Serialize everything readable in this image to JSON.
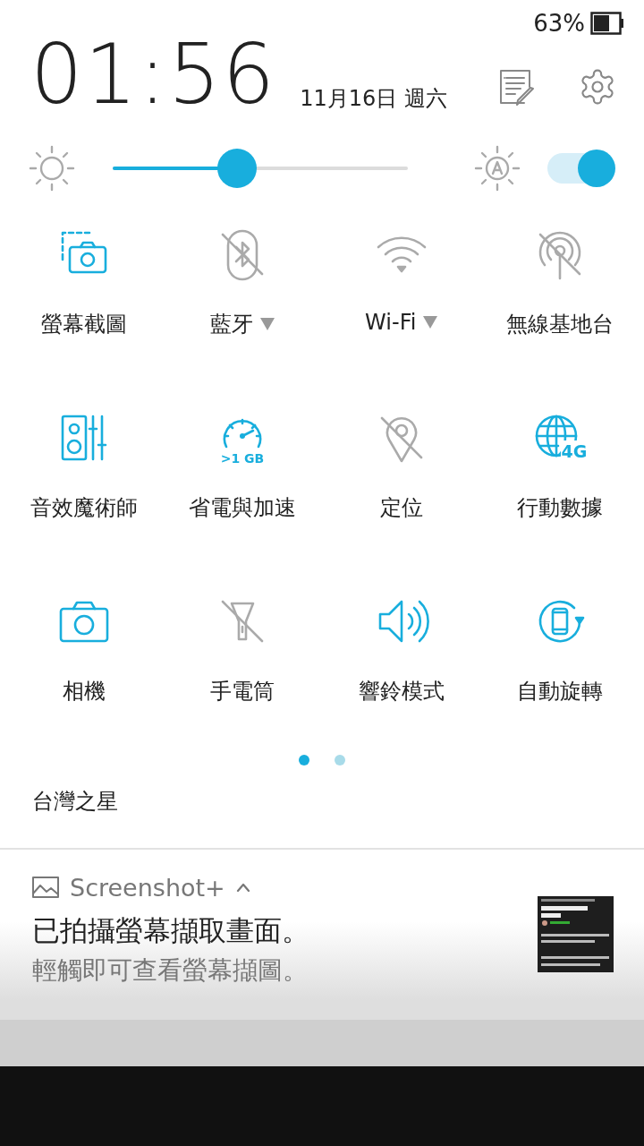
{
  "status_bar": {
    "battery_text": "63%"
  },
  "header": {
    "time": "01:56",
    "date": "11月16日 週六"
  },
  "brightness": {
    "level": 0.42,
    "auto": true
  },
  "tiles": [
    {
      "label": "螢幕截圖",
      "on": true,
      "kind": "plain"
    },
    {
      "label": "藍牙",
      "on": false,
      "kind": "dropdown"
    },
    {
      "label": "Wi-Fi",
      "on": false,
      "kind": "dropdown"
    },
    {
      "label": "無線基地台",
      "on": false,
      "kind": "plain"
    },
    {
      "label": "音效魔術師",
      "on": true,
      "kind": "plain"
    },
    {
      "label": "省電與加速",
      "on": true,
      "kind": "plain",
      "badge": ">1 GB"
    },
    {
      "label": "定位",
      "on": false,
      "kind": "plain"
    },
    {
      "label": "行動數據",
      "on": true,
      "kind": "plain",
      "badge": "4G"
    },
    {
      "label": "相機",
      "on": true,
      "kind": "plain"
    },
    {
      "label": "手電筒",
      "on": false,
      "kind": "plain"
    },
    {
      "label": "響鈴模式",
      "on": true,
      "kind": "plain"
    },
    {
      "label": "自動旋轉",
      "on": true,
      "kind": "plain"
    }
  ],
  "pages": [
    {
      "selected": true
    },
    {
      "selected": false
    }
  ],
  "carrier": "台灣之星",
  "notification": {
    "app": "Screenshot+",
    "expanded": true,
    "title": "已拍攝螢幕擷取畫面。",
    "text": "輕觸即可查看螢幕擷圖。"
  }
}
